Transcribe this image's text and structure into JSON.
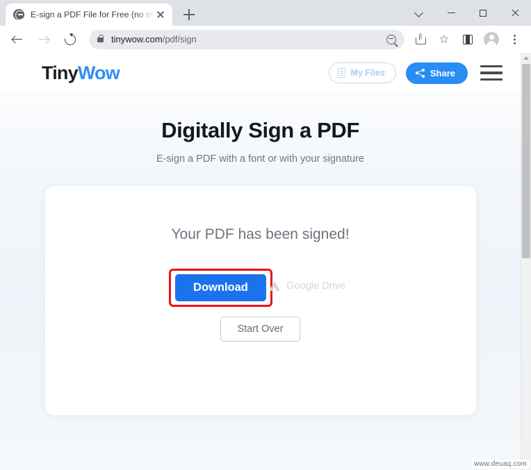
{
  "browser": {
    "tab": {
      "title": "E-sign a PDF File for Free (no sig",
      "favicon": "globe-icon",
      "close": "close-icon"
    },
    "new_tab": "+",
    "window_controls": {
      "chevron": "chevron-down-icon",
      "minimize": "minimize-icon",
      "maximize": "maximize-icon",
      "close": "close-icon"
    },
    "nav": {
      "back": "back-arrow-icon",
      "forward": "forward-arrow-icon",
      "reload": "reload-icon"
    },
    "omnibox": {
      "lock": "lock-icon",
      "domain": "tinywow.com",
      "path": "/pdf/sign",
      "zoom": "zoom-out-icon"
    },
    "toolbar_icons": {
      "share": "share-icon",
      "bookmark": "star-icon",
      "side_panel": "side-panel-icon",
      "profile": "avatar-icon",
      "menu": "kebab-menu-icon"
    }
  },
  "site": {
    "logo": {
      "first": "Tiny",
      "second": "Wow"
    },
    "my_files_label": "My Files",
    "share_label": "Share",
    "menu": "hamburger-icon"
  },
  "hero": {
    "title": "Digitally Sign a PDF",
    "subtitle": "E-sign a PDF with a font or with your signature"
  },
  "card": {
    "signed_message": "Your PDF has been signed!",
    "download_label": "Download",
    "google_drive_label": "Google Drive",
    "start_over_label": "Start Over"
  },
  "watermark": "www.deuaq.com",
  "colors": {
    "brand_blue": "#2e8ef7",
    "download_blue": "#1a73ec",
    "highlight_red": "#ee1111",
    "heading_dark": "#14181f",
    "muted_gray": "#6c7681"
  }
}
